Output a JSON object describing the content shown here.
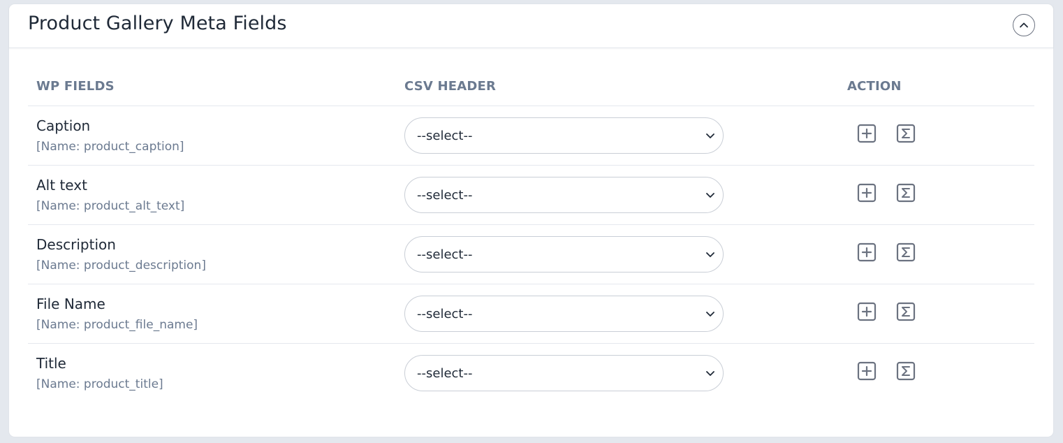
{
  "panel": {
    "title": "Product Gallery Meta Fields",
    "collapse_icon": "chevron-up-icon"
  },
  "table": {
    "headers": {
      "wp_fields": "WP FIELDS",
      "csv_header": "CSV HEADER",
      "action": "ACTION"
    },
    "rows": [
      {
        "label": "Caption",
        "name": "[Name: product_caption]",
        "select_value": "--select--"
      },
      {
        "label": "Alt text",
        "name": "[Name: product_alt_text]",
        "select_value": "--select--"
      },
      {
        "label": "Description",
        "name": "[Name: product_description]",
        "select_value": "--select--"
      },
      {
        "label": "File Name",
        "name": "[Name: product_file_name]",
        "select_value": "--select--"
      },
      {
        "label": "Title",
        "name": "[Name: product_title]",
        "select_value": "--select--"
      }
    ],
    "action_icons": [
      "plus-square-icon",
      "sigma-square-icon"
    ]
  },
  "colors": {
    "background": "#e4e8ee",
    "text": "#1f2937",
    "muted": "#6b7a90",
    "icon": "#6b7280"
  }
}
